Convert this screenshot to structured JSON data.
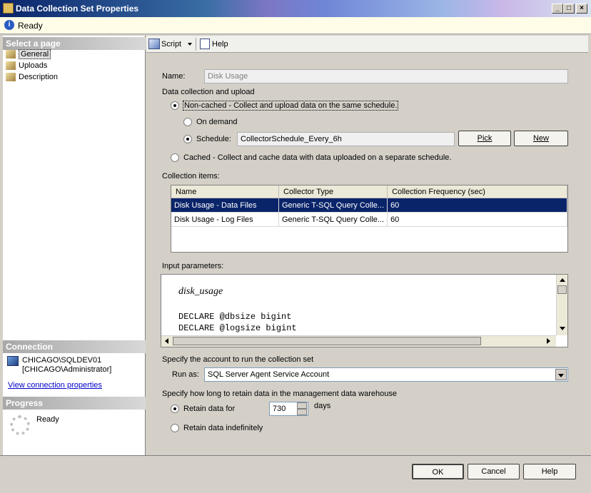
{
  "window": {
    "title": "Data Collection Set Properties"
  },
  "status": {
    "text": "Ready"
  },
  "nav": {
    "header": "Select a page",
    "items": [
      {
        "label": "General"
      },
      {
        "label": "Uploads"
      },
      {
        "label": "Description"
      }
    ]
  },
  "connection": {
    "header": "Connection",
    "server": "CHICAGO\\SQLDEV01",
    "user": "[CHICAGO\\Administrator]",
    "link": "View connection properties"
  },
  "progress": {
    "header": "Progress",
    "status": "Ready"
  },
  "toolbar": {
    "script_label": "Script",
    "help_label": "Help"
  },
  "form": {
    "name_label": "Name:",
    "name_value": "Disk Usage",
    "collection_upload_label": "Data collection and upload",
    "noncached_label": "Non-cached - Collect and upload data on the same schedule.",
    "on_demand_label": "On demand",
    "schedule_label": "Schedule:",
    "schedule_value": "CollectorSchedule_Every_6h",
    "pick_label": "Pick",
    "new_label": "New",
    "cached_label": "Cached - Collect and cache data with data uploaded on a separate schedule.",
    "collection_items_label": "Collection items:",
    "columns": [
      "Name",
      "Collector Type",
      "Collection Frequency (sec)"
    ],
    "rows": [
      [
        "Disk Usage - Data Files",
        "Generic T-SQL Query Colle...",
        "60"
      ],
      [
        "Disk Usage - Log Files",
        "Generic T-SQL Query Colle...",
        "60"
      ]
    ],
    "input_params_label": "Input parameters:",
    "code_heading": "disk_usage",
    "code_lines": [
      "DECLARE @dbsize bigint",
      "DECLARE @logsize bigint"
    ],
    "account_label": "Specify the account to run the collection set",
    "run_as_label": "Run as:",
    "run_as_value": "SQL Server Agent Service Account",
    "retain_label": "Specify how long to retain data in the management data warehouse",
    "retain_for_label": "Retain data for",
    "retain_value": "730",
    "days_label": "days",
    "retain_indef_label": "Retain data indefinitely"
  },
  "footer": {
    "ok_label": "OK",
    "cancel_label": "Cancel",
    "help_label": "Help"
  }
}
